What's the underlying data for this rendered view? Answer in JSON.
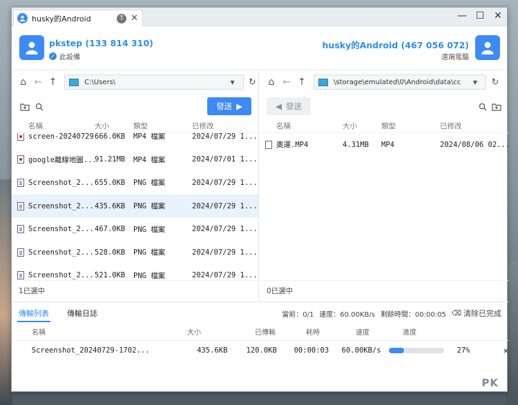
{
  "window": {
    "tab_title": "husky的Android",
    "tab_badge": "T"
  },
  "local": {
    "name": "pkstep (133 814 310)",
    "subtitle": "此設備",
    "path": "C:\\Users\\"
  },
  "remote": {
    "name": "husky的Android (467 056 072)",
    "subtitle": "遠端電腦",
    "path": "\\storage\\emulated\\0\\Android\\data\\cc"
  },
  "buttons": {
    "send": "發送"
  },
  "columns": {
    "name": "名稱",
    "size": "大小",
    "type": "類型",
    "modified": "已修改"
  },
  "local_files": [
    {
      "name": "screen-20240729-...",
      "size": "666.0KB",
      "type": "MP4 檔案",
      "modified": "2024/07/29 1...",
      "kind": "video"
    },
    {
      "name": "google離線地圖...",
      "size": "91.21MB",
      "type": "MP4 檔案",
      "modified": "2024/07/01 1...",
      "kind": "video"
    },
    {
      "name": "Screenshot_2...",
      "size": "655.0KB",
      "type": "PNG 檔案",
      "modified": "2024/07/29 1...",
      "kind": "image"
    },
    {
      "name": "Screenshot_2...",
      "size": "435.6KB",
      "type": "PNG 檔案",
      "modified": "2024/07/29 1...",
      "kind": "image",
      "selected": true
    },
    {
      "name": "Screenshot_2...",
      "size": "467.0KB",
      "type": "PNG 檔案",
      "modified": "2024/07/29 1...",
      "kind": "image"
    },
    {
      "name": "Screenshot_2...",
      "size": "528.0KB",
      "type": "PNG 檔案",
      "modified": "2024/07/29 1...",
      "kind": "image"
    },
    {
      "name": "Screenshot_2...",
      "size": "521.0KB",
      "type": "PNG 檔案",
      "modified": "2024/07/29 1...",
      "kind": "image"
    }
  ],
  "remote_files": [
    {
      "name": "奧運.MP4",
      "size": "4.31MB",
      "type": "MP4",
      "modified": "2024/08/06 02..."
    }
  ],
  "local_selected": "1已選中",
  "remote_selected": "0已選中",
  "bottom": {
    "tab_list": "傳輸列表",
    "tab_log": "傳輸日誌",
    "current": "當前：0/1",
    "speed": "速度：60.00KB/s",
    "remaining": "剩餘時間：00:00:05",
    "clear": "清除已完成",
    "headers": {
      "name": "名稱",
      "size": "大小",
      "transferred": "已傳輸",
      "elapsed": "耗時",
      "speed": "速度",
      "progress": "進度"
    },
    "transfer": {
      "name": "Screenshot_20240729-1702...",
      "size": "435.6KB",
      "transferred": "120.0KB",
      "elapsed": "00:00:03",
      "speed": "60.00KB/s",
      "progress_pct": 27,
      "progress_label": "27%"
    }
  },
  "watermark": "PK",
  "colors": {
    "accent": "#3d8af7",
    "name_blue": "#2f8cf0",
    "selected_row": "#e8f2fd"
  }
}
